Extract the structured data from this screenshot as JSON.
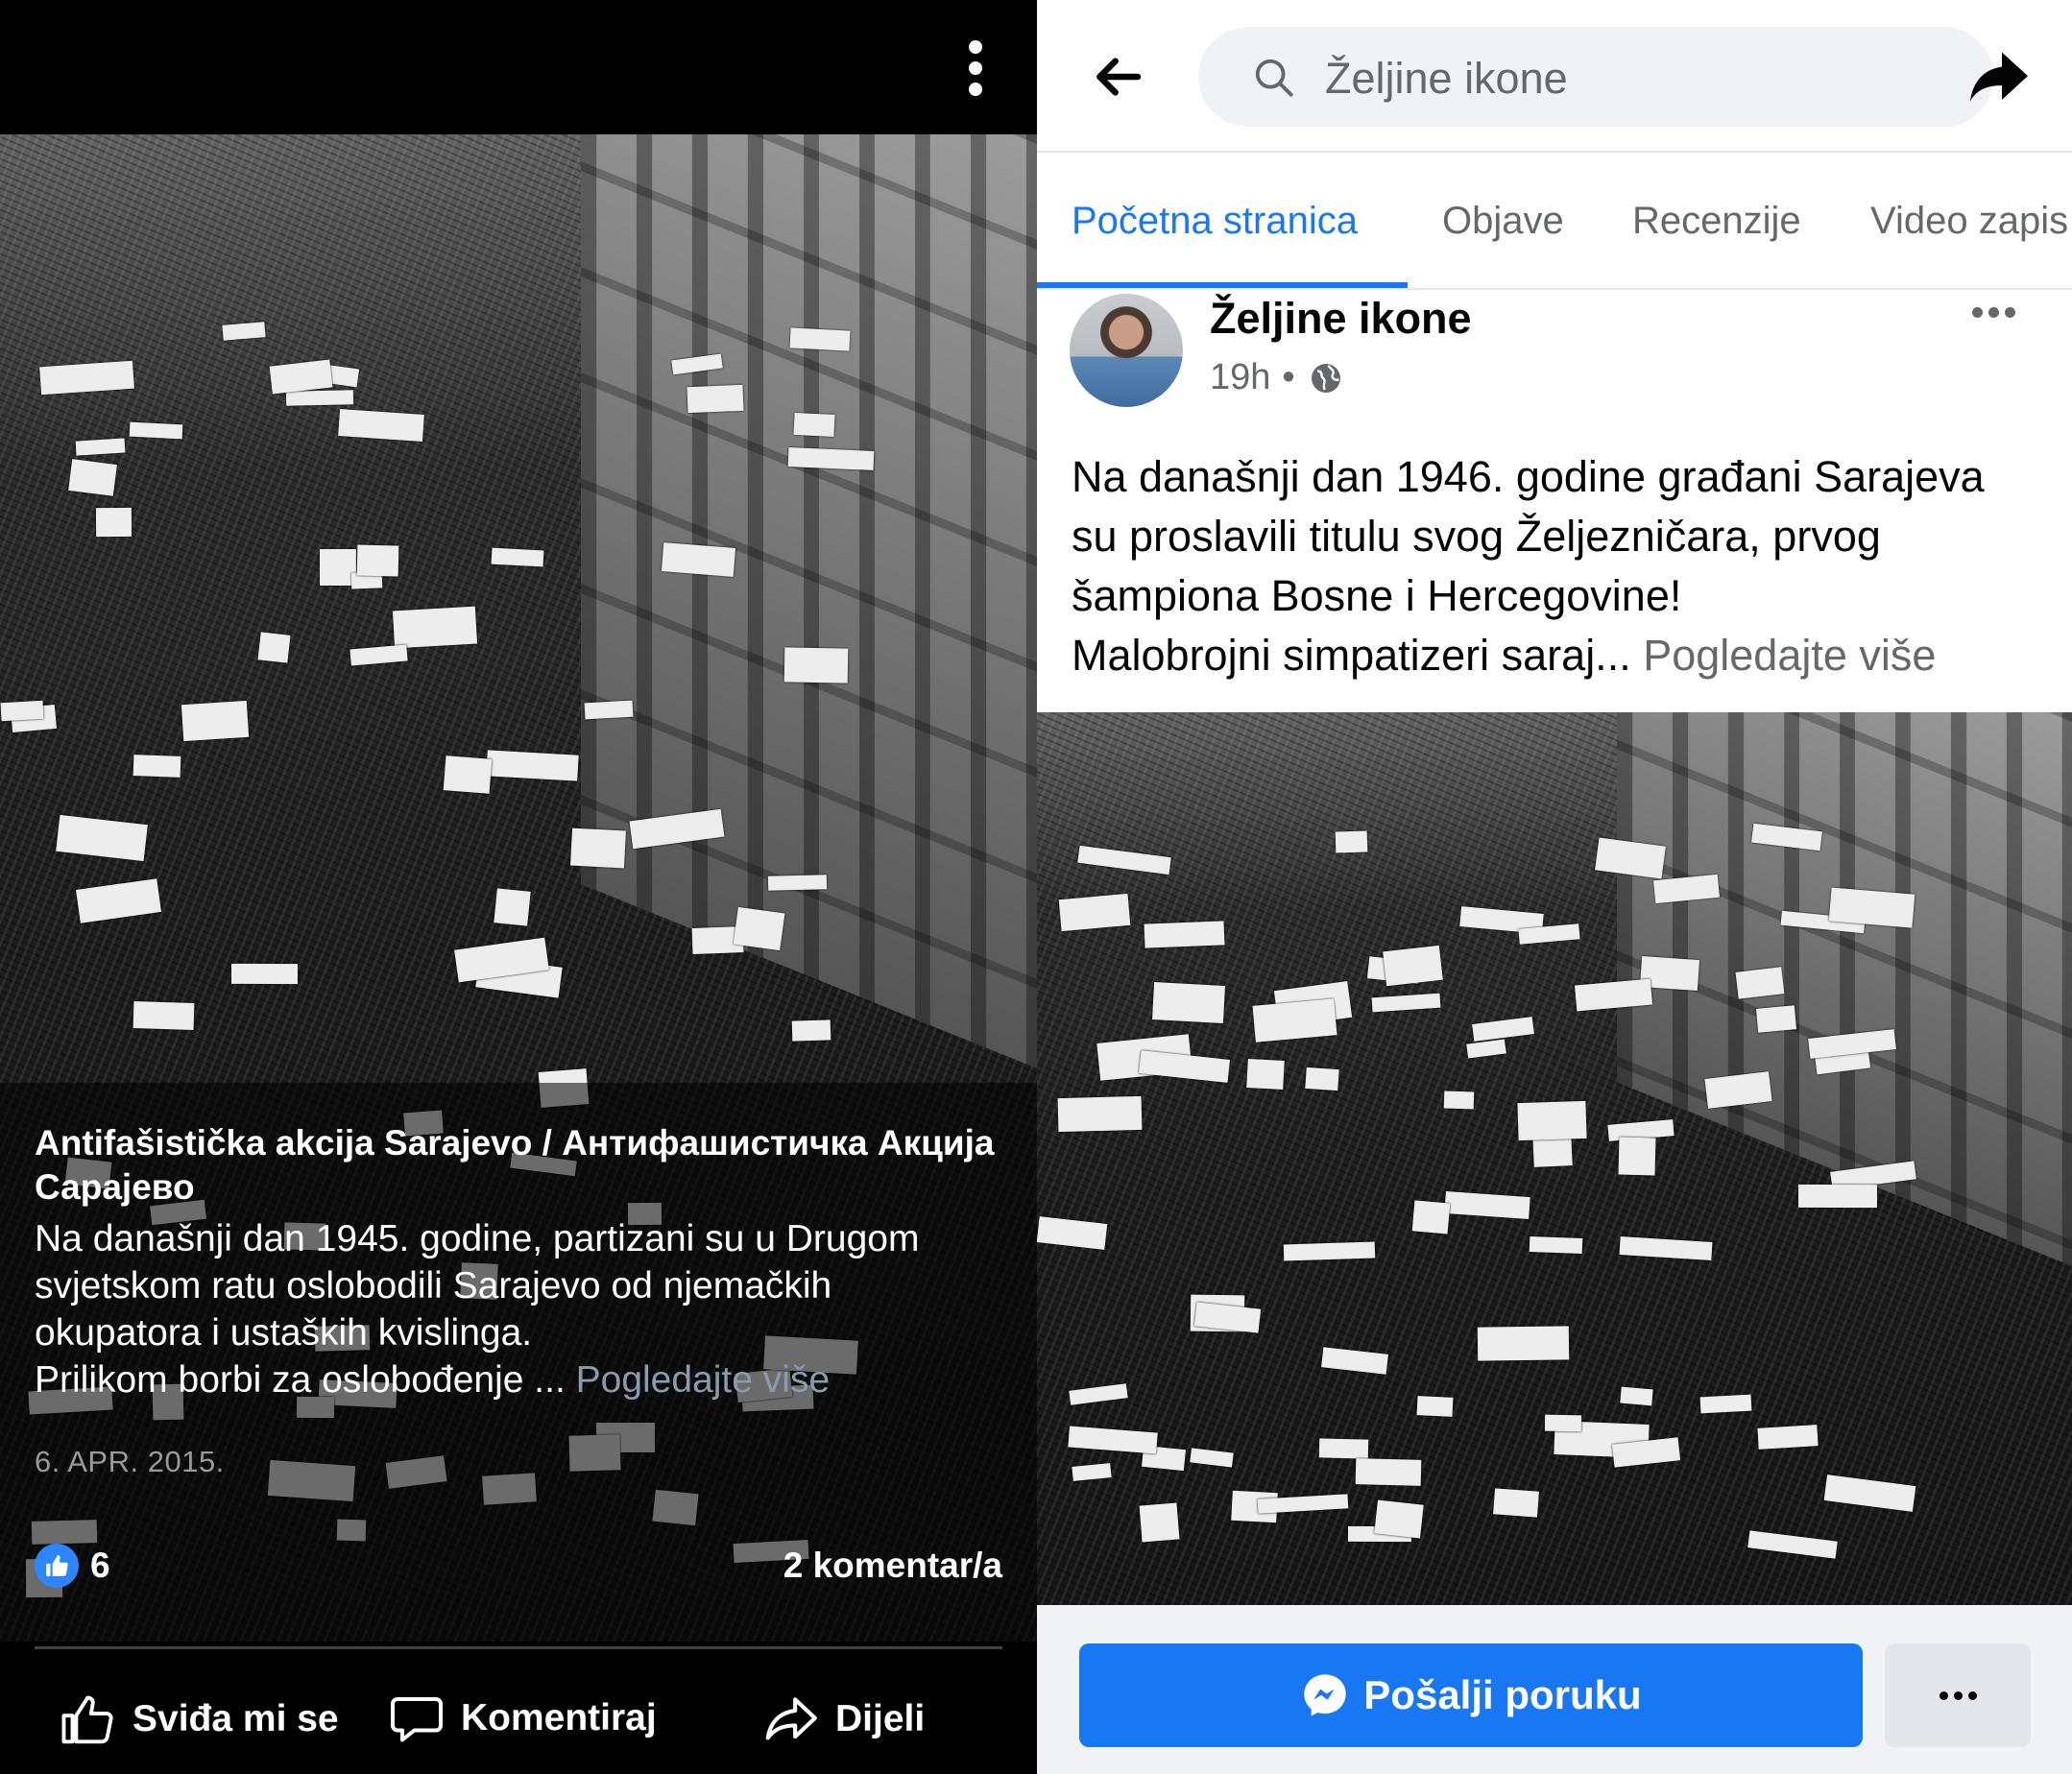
{
  "left_panel": {
    "page_name": "Antifašistička akcija Sarajevo / Антифашистичка Акција Сарајево",
    "post_lines": [
      "Na današnji dan 1945. godine, partizani su u Drugom",
      "svjetskom ratu oslobodili Sarajevo od njemačkih",
      "okupatora i ustaških kvislinga.",
      "Prilikom borbi za oslobođenje ..."
    ],
    "see_more": "Pogledajte više",
    "date": "6. APR. 2015.",
    "like_count": "6",
    "comment_count": "2 komentar/a",
    "actions": {
      "like": "Sviđa mi se",
      "comment": "Komentiraj",
      "share": "Dijeli"
    },
    "icons": [
      "more-vertical-icon",
      "like-reaction-icon",
      "thumbs-up-icon",
      "comment-icon",
      "share-icon"
    ]
  },
  "right_panel": {
    "search_text": "Željine ikone",
    "tabs": [
      "Početna stranica",
      "Objave",
      "Recenzije",
      "Video zapis"
    ],
    "active_tab": "Početna stranica",
    "author": "Željine ikone",
    "time": "19h",
    "separator": "•",
    "post_lines": [
      "Na današnji dan 1946. godine građani Sarajeva",
      "su proslavili titulu svog Željezničara, prvog",
      "šampiona Bosne i Hercegovine!",
      "Malobrojni simpatizeri saraj..."
    ],
    "see_more": "Pogledajte više",
    "message_button": "Pošalji poruku",
    "icons": [
      "back-arrow-icon",
      "search-icon",
      "share-arrow-icon",
      "globe-icon",
      "more-horizontal-icon",
      "messenger-icon"
    ]
  },
  "colors": {
    "facebook_blue": "#1877f2",
    "secondary_text": "#65676b",
    "search_bg": "#f0f2f5",
    "like_blue": "#2d86ff"
  }
}
